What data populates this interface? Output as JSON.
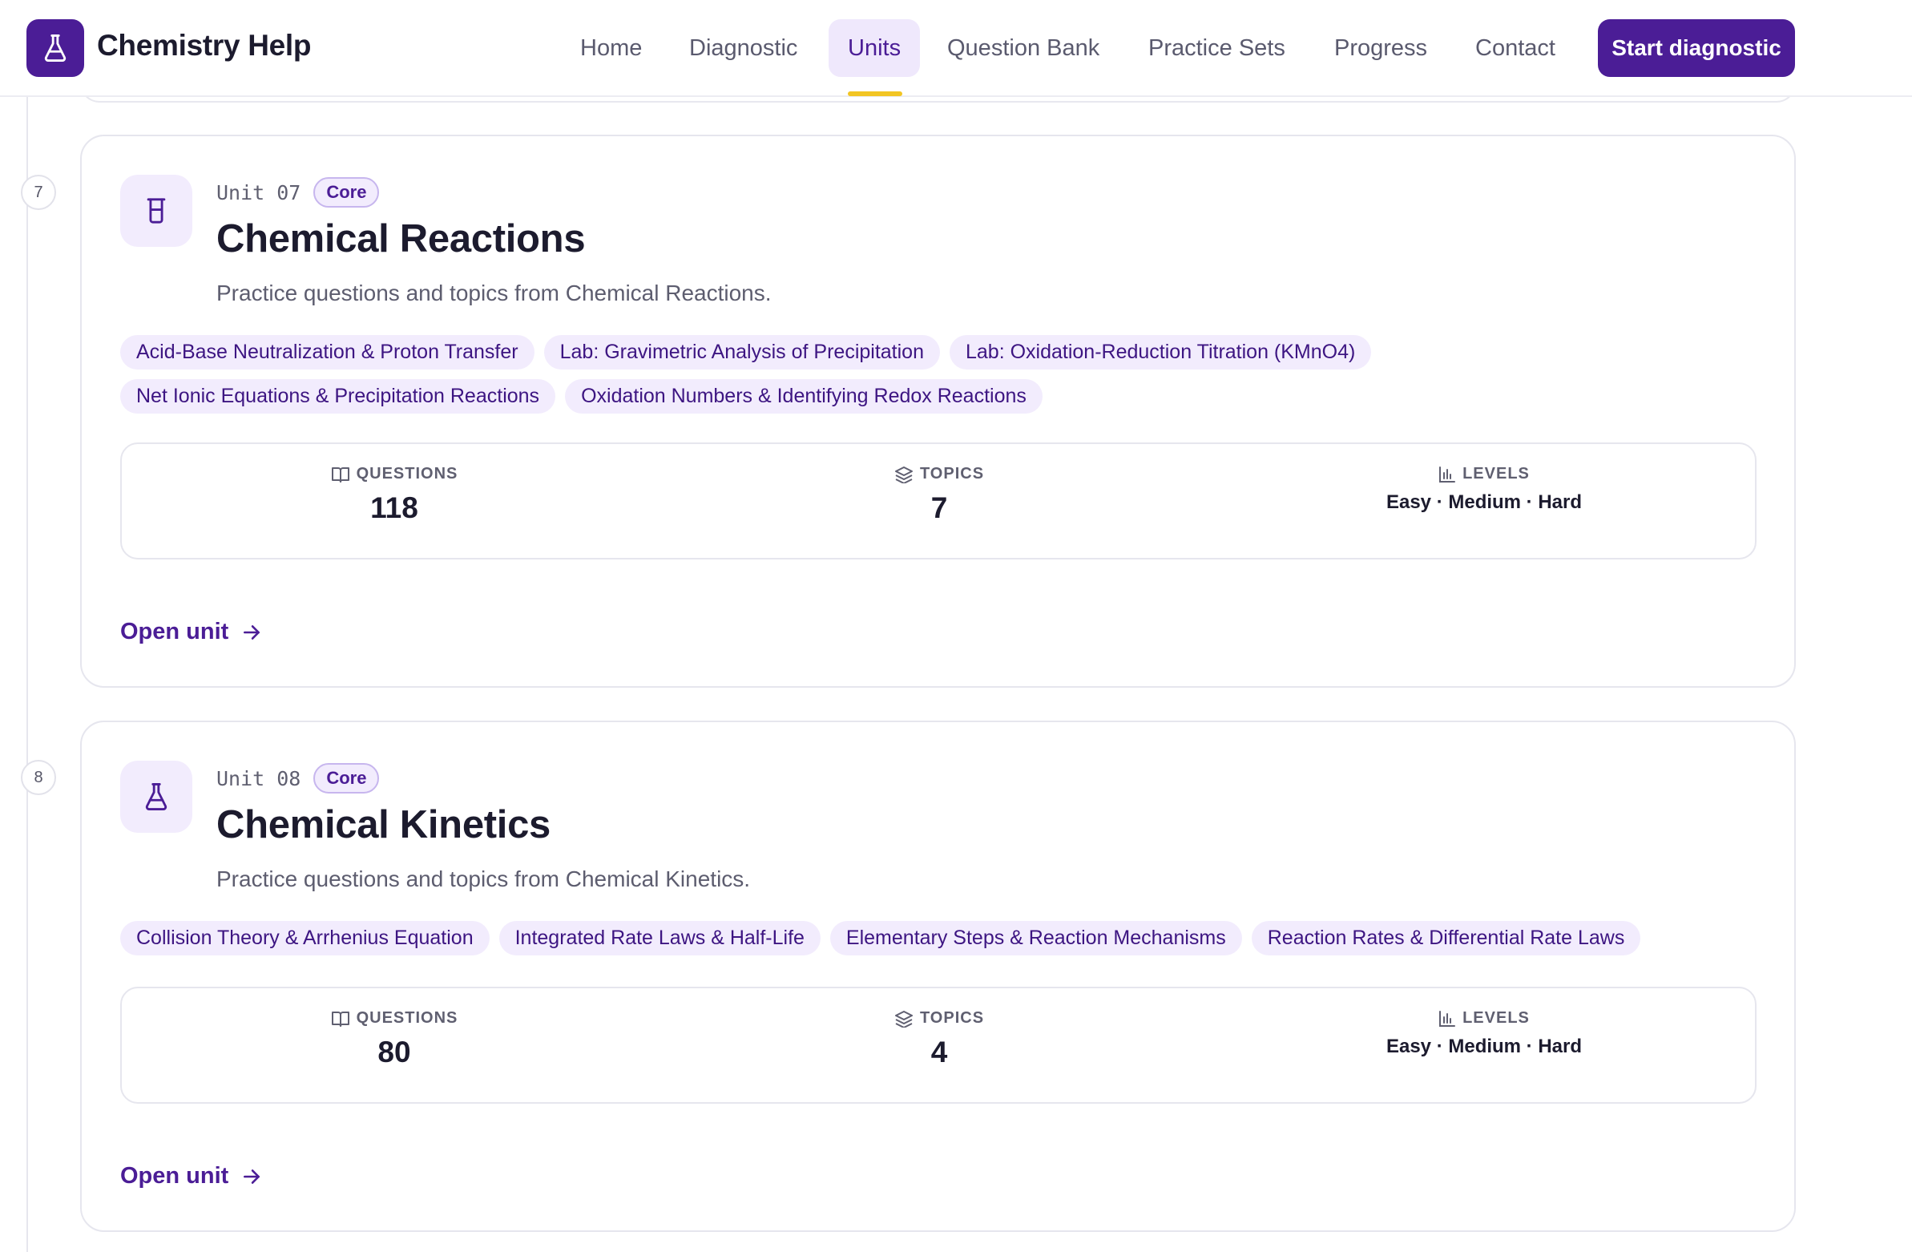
{
  "brand": {
    "name": "Chemistry Help",
    "logo_icon": "flask-icon"
  },
  "nav": {
    "items": [
      {
        "label": "Home",
        "active": false
      },
      {
        "label": "Diagnostic",
        "active": false
      },
      {
        "label": "Units",
        "active": true
      },
      {
        "label": "Question Bank",
        "active": false
      },
      {
        "label": "Practice Sets",
        "active": false
      },
      {
        "label": "Progress",
        "active": false
      },
      {
        "label": "Contact",
        "active": false
      }
    ],
    "cta_label": "Start diagnostic"
  },
  "colors": {
    "brand": "#4b1d96",
    "accent_underline": "#f2c523",
    "chip_bg": "#f2ecfd"
  },
  "units": [
    {
      "step": "7",
      "code": "Unit 07",
      "badge": "Core",
      "icon": "beaker-icon",
      "title": "Chemical Reactions",
      "description": "Practice questions and topics from Chemical Reactions.",
      "topics": [
        "Acid-Base Neutralization & Proton Transfer",
        "Lab: Gravimetric Analysis of Precipitation",
        "Lab: Oxidation-Reduction Titration (KMnO4)",
        "Net Ionic Equations & Precipitation Reactions",
        "Oxidation Numbers & Identifying Redox Reactions"
      ],
      "stats": {
        "questions_label": "QUESTIONS",
        "questions": "118",
        "topics_label": "TOPICS",
        "topics": "7",
        "levels_label": "LEVELS",
        "levels": "Easy · Medium · Hard"
      },
      "open_label": "Open unit"
    },
    {
      "step": "8",
      "code": "Unit 08",
      "badge": "Core",
      "icon": "flask-icon",
      "title": "Chemical Kinetics",
      "description": "Practice questions and topics from Chemical Kinetics.",
      "topics": [
        "Collision Theory & Arrhenius Equation",
        "Integrated Rate Laws & Half-Life",
        "Elementary Steps & Reaction Mechanisms",
        "Reaction Rates & Differential Rate Laws"
      ],
      "stats": {
        "questions_label": "QUESTIONS",
        "questions": "80",
        "topics_label": "TOPICS",
        "topics": "4",
        "levels_label": "LEVELS",
        "levels": "Easy · Medium · Hard"
      },
      "open_label": "Open unit"
    }
  ]
}
